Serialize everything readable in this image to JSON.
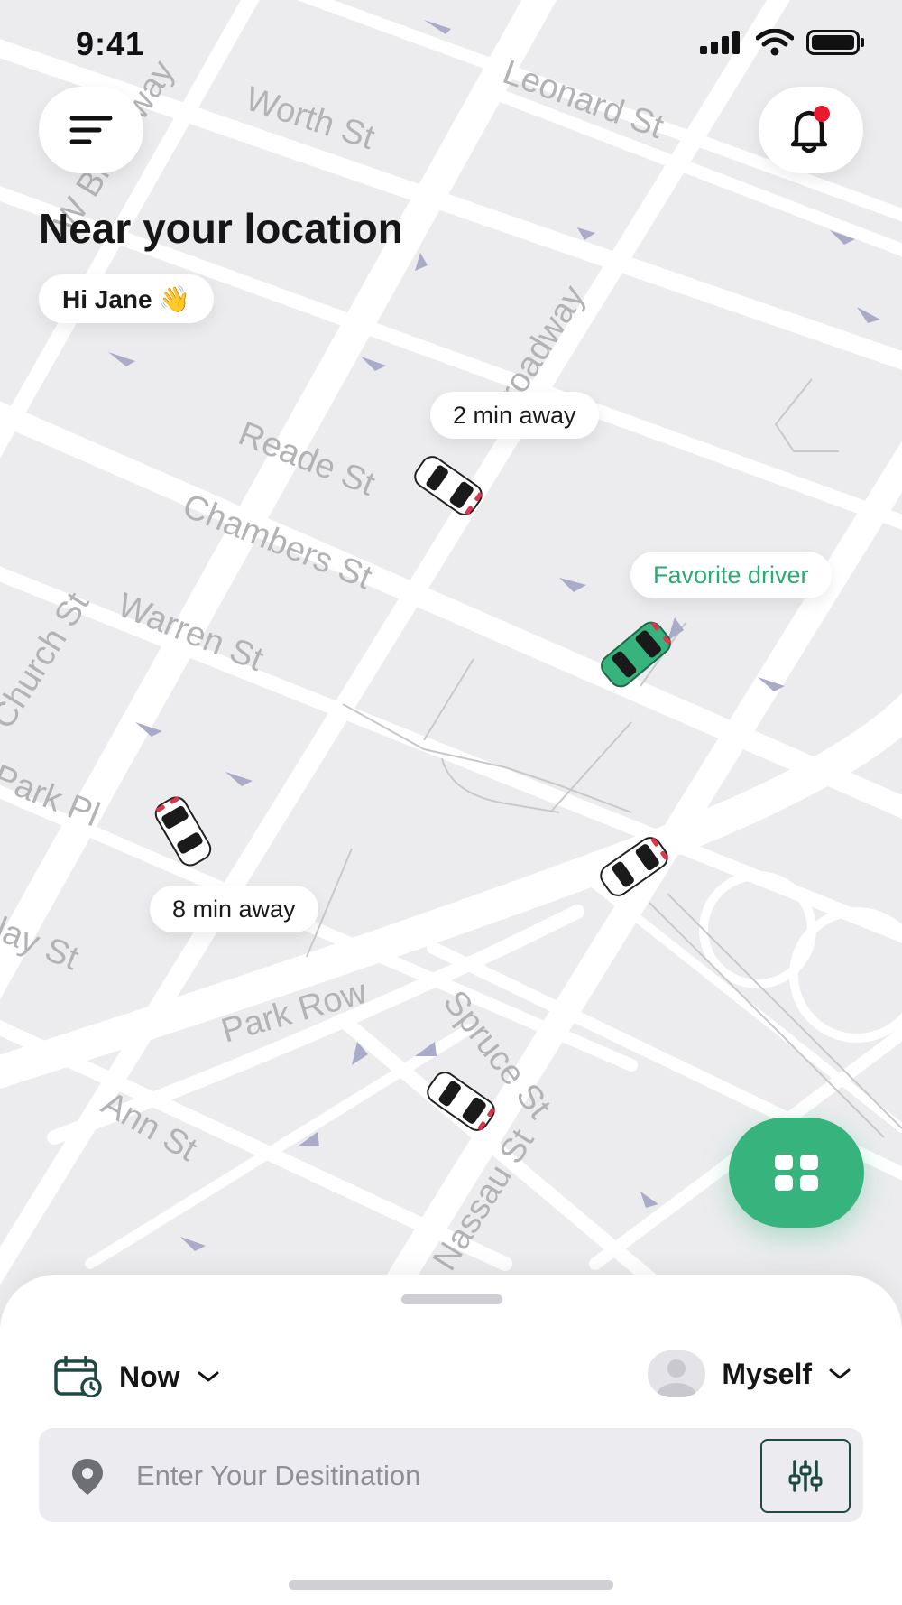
{
  "status_bar": {
    "time": "9:41"
  },
  "header": {
    "title": "Near your location",
    "greeting": "Hi Jane 👋"
  },
  "map": {
    "street_labels": [
      "Worth St",
      "Leonard St",
      "W Broadway",
      "Broadway",
      "Reade St",
      "Chambers St",
      "Warren St",
      "Church St",
      "Park Pl",
      "Barclay St",
      "Park Row",
      "Spruce St",
      "Ann St",
      "St",
      "Nassau St"
    ],
    "bubbles": {
      "two_min": "2 min away",
      "favorite": "Favorite driver",
      "eight_min": "8 min away"
    }
  },
  "booking": {
    "when_label": "Now",
    "who_label": "Myself",
    "destination_placeholder": "Enter Your Desitination"
  },
  "colors": {
    "accent": "#37b47d",
    "notification_dot": "#e8192c",
    "map_background": "#ececee",
    "road": "#ffffff",
    "dark_teal": "#1e4a44"
  },
  "icons": {
    "menu": "menu-icon",
    "bell": "bell-icon",
    "grid": "grid-icon",
    "calendar": "calendar-clock-icon",
    "location": "location-pin-icon",
    "filter": "filter-sliders-icon",
    "avatar": "avatar-icon"
  }
}
